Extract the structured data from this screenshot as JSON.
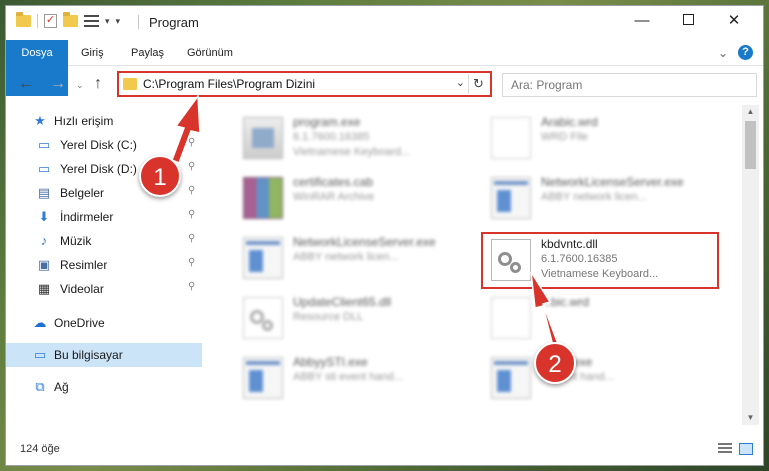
{
  "window": {
    "title": "Program",
    "minimize": "—",
    "close": "✕"
  },
  "ribbon": {
    "tabs": [
      "Dosya",
      "Giriş",
      "Paylaş",
      "Görünüm"
    ],
    "expand": "⌄",
    "help": "?"
  },
  "nav": {
    "back": "←",
    "forward": "→",
    "recent": "⌄",
    "up": "↑",
    "address": "C:\\Program Files\\Program Dizini",
    "dropdown": "⌄",
    "refresh": "↻",
    "search_placeholder": "Ara: Program"
  },
  "sidebar": {
    "items": [
      {
        "label": "Hızlı erişim",
        "icon": "star-icon",
        "glyph": "★"
      },
      {
        "label": "Yerel Disk (C:)",
        "icon": "disk-icon",
        "glyph": "▭"
      },
      {
        "label": "Yerel Disk (D:)",
        "icon": "disk-icon",
        "glyph": "▭"
      },
      {
        "label": "Belgeler",
        "icon": "documents-icon",
        "glyph": "▤"
      },
      {
        "label": "İndirmeler",
        "icon": "download-icon",
        "glyph": "⬇"
      },
      {
        "label": "Müzik",
        "icon": "music-icon",
        "glyph": "♪"
      },
      {
        "label": "Resimler",
        "icon": "pictures-icon",
        "glyph": "▣"
      },
      {
        "label": "Videolar",
        "icon": "videos-icon",
        "glyph": "▦"
      },
      {
        "label": "OneDrive",
        "icon": "cloud-icon",
        "glyph": "☁"
      },
      {
        "label": "Bu bilgisayar",
        "icon": "computer-icon",
        "glyph": "▭"
      },
      {
        "label": "Ağ",
        "icon": "network-icon",
        "glyph": "⧉"
      }
    ],
    "pin": "📌"
  },
  "files": [
    {
      "name": "program.exe",
      "line2": "6.1.7600.16385",
      "line3": "Vietnamese Keyboard...",
      "icon": "exe-icon"
    },
    {
      "name": "Arabic.wrd",
      "line2": "WRD File",
      "line3": "",
      "icon": "blank-file-icon"
    },
    {
      "name": "certificates.cab",
      "line2": "WinRAR Archive",
      "line3": "",
      "icon": "winrar-icon"
    },
    {
      "name": "NetworkLicenseServer.exe",
      "line2": "ABBY network licen...",
      "line3": "",
      "icon": "app-icon"
    },
    {
      "name": "NetworkLicenseServer.exe",
      "line2": "ABBY network licen...",
      "line3": "",
      "icon": "app-icon"
    },
    {
      "name": "kbdvntc.dll",
      "line2": "6.1.7600.16385",
      "line3": "Vietnamese Keyboard...",
      "icon": "dll-gear-icon"
    },
    {
      "name": "UpdateClient65.dll",
      "line2": "Resource DLL",
      "line3": "",
      "icon": "dll-gear-icon"
    },
    {
      "name": "...bic.wrd",
      "line2": "",
      "line3": "",
      "icon": "blank-file-icon"
    },
    {
      "name": "AbbyySTI.exe",
      "line2": "ABBY sti event hand...",
      "line3": "",
      "icon": "app-icon"
    },
    {
      "name": "...STI.exe",
      "line2": "...event hand...",
      "line3": "",
      "icon": "app-icon"
    }
  ],
  "status": {
    "count": "124 öğe"
  },
  "annotations": {
    "badge1": "1",
    "badge2": "2"
  },
  "colors": {
    "accent": "#1979ca",
    "highlight": "#d9342b",
    "selected": "#cce4f7"
  }
}
